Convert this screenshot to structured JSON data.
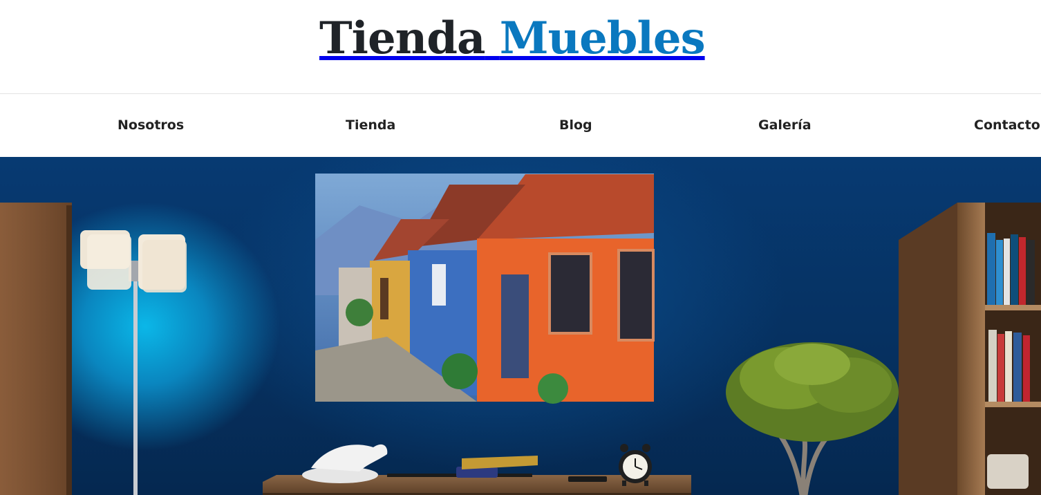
{
  "brand": {
    "word1": "Tienda",
    "word2": "Muebles",
    "color_dark": "#1f2328",
    "color_accent": "#0a78bf"
  },
  "nav": {
    "items": [
      "Nosotros",
      "Tienda",
      "Blog",
      "Galería",
      "Contacto"
    ]
  },
  "hero": {
    "wall_color": "#063a72",
    "lamp_glow_color": "#0bb7e8"
  }
}
